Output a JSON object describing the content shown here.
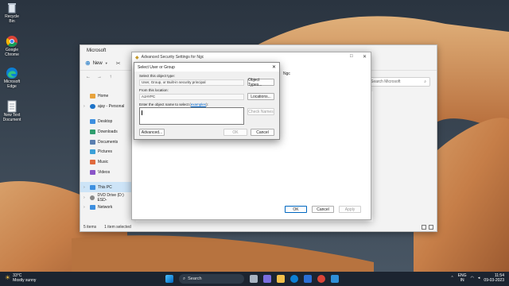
{
  "desktop": {
    "icons": [
      {
        "label": "Recycle Bin",
        "icon": "recycle-bin-icon"
      },
      {
        "label": "Google Chrome",
        "icon": "chrome-icon"
      },
      {
        "label": "Microsoft Edge",
        "icon": "edge-icon"
      },
      {
        "label": "New Text Document",
        "icon": "text-document-icon"
      }
    ]
  },
  "explorer": {
    "title": "Microsoft",
    "new_label": "New",
    "search_placeholder": "Search Microsoft",
    "sidebar": [
      {
        "label": "Home",
        "icon": "home-icon",
        "chevron": false,
        "color": "#e8a33d"
      },
      {
        "label": "ajay - Personal",
        "icon": "onedrive-icon",
        "chevron": true,
        "color": "#1e73c8"
      },
      {
        "label": "Desktop",
        "icon": "desktop-icon",
        "chevron": false,
        "color": "#3d8fe0"
      },
      {
        "label": "Downloads",
        "icon": "downloads-icon",
        "chevron": false,
        "color": "#2f9e6e"
      },
      {
        "label": "Documents",
        "icon": "documents-icon",
        "chevron": false,
        "color": "#5a7fb0"
      },
      {
        "label": "Pictures",
        "icon": "pictures-icon",
        "chevron": false,
        "color": "#3aa0d8"
      },
      {
        "label": "Music",
        "icon": "music-icon",
        "chevron": false,
        "color": "#e06a3d"
      },
      {
        "label": "Videos",
        "icon": "videos-icon",
        "chevron": false,
        "color": "#8a55c8"
      },
      {
        "label": "",
        "icon": "",
        "chevron": false,
        "color": "transparent"
      },
      {
        "label": "This PC",
        "icon": "this-pc-icon",
        "chevron": true,
        "color": "#3d8fe0",
        "selected": true
      },
      {
        "label": "DVD Drive (D:) ESD-",
        "icon": "dvd-icon",
        "chevron": true,
        "color": "#888888"
      },
      {
        "label": "Network",
        "icon": "network-icon",
        "chevron": true,
        "color": "#3d8fe0"
      }
    ],
    "status_items": "5 items",
    "status_selected": "1 item selected"
  },
  "advanced": {
    "title": "Advanced Security Settings for Ngc",
    "side_text": "Ngc",
    "ok_label": "OK",
    "cancel_label": "Cancel",
    "apply_label": "Apply"
  },
  "dialog": {
    "title": "Select User or Group",
    "object_type_label": "Select this object type:",
    "object_type_value": "User, Group, or Built-in security principal",
    "object_types_button": "Object Types...",
    "location_label": "From this location:",
    "location_value": "AJAYPC",
    "locations_button": "Locations...",
    "enter_label": "Enter the object name to select",
    "examples_link": "examples",
    "check_names_button": "Check Names",
    "advanced_button": "Advanced...",
    "ok_button": "OK",
    "cancel_button": "Cancel"
  },
  "taskbar": {
    "temp": "33°C",
    "weather": "Mostly sunny",
    "search_label": "Search",
    "lang_line1": "ENG",
    "lang_line2": "IN",
    "time": "11:54",
    "date": "09-03-2023"
  }
}
